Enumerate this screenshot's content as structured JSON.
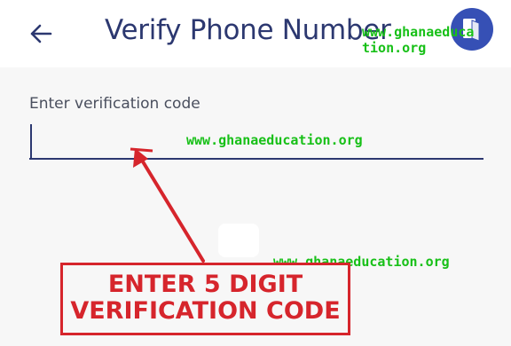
{
  "header": {
    "title": "Verify Phone Number",
    "back_icon": "arrow-left-icon",
    "logo_icon": "app-logo-icon"
  },
  "form": {
    "label": "Enter verification code",
    "value": "",
    "placeholder": ""
  },
  "watermarks": {
    "top_line1": "www.ghanaeduca",
    "top_line2": "tion.org",
    "middle": "www.ghanaeducation.org",
    "bottom": "www.ghanaeducation.org"
  },
  "annotation": {
    "line1": "ENTER 5 DIGIT",
    "line2": "VERIFICATION CODE",
    "color": "#d6252c"
  },
  "colors": {
    "primary": "#2c3870",
    "logo_bg": "#3650b5",
    "watermark": "#18c018"
  }
}
